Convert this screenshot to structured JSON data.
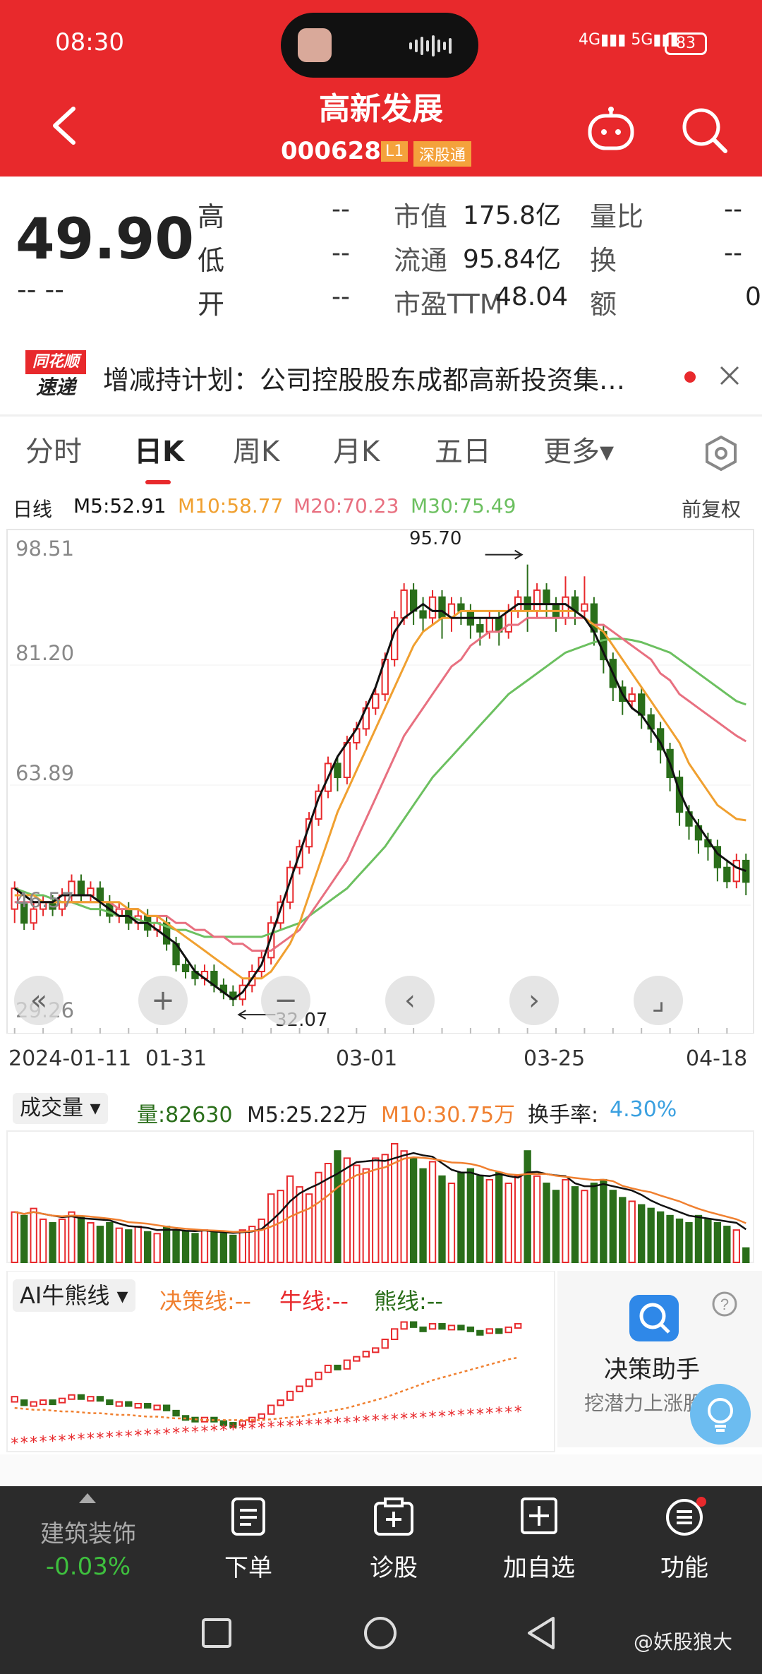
{
  "status_bar": {
    "time": "08:30",
    "network": "4G 5G",
    "battery": "83"
  },
  "header": {
    "title": "高新发展",
    "code": "000628",
    "level_badge": "L1",
    "market_badge": "深股通"
  },
  "quote": {
    "price": "49.90",
    "change": "-- --",
    "stats": [
      {
        "label": "高",
        "value": "--"
      },
      {
        "label": "低",
        "value": "--"
      },
      {
        "label": "开",
        "value": "--"
      },
      {
        "label": "市值",
        "value": "175.8亿"
      },
      {
        "label": "流通",
        "value": "95.84亿"
      },
      {
        "label": "市盈TTM",
        "value": "48.04"
      },
      {
        "label": "量比",
        "value": "--"
      },
      {
        "label": "换",
        "value": "--"
      },
      {
        "label": "额",
        "value": "0"
      }
    ]
  },
  "news": {
    "logo_top": "同花顺",
    "logo_bottom": "速递",
    "text": "增减持计划：公司控股股东成都高新投资集…"
  },
  "tabs": [
    "分时",
    "日K",
    "周K",
    "月K",
    "五日",
    "更多▾"
  ],
  "active_tab": "日K",
  "ma_line": {
    "label": "日线",
    "m5": "M5:52.91",
    "m10": "M10:58.77",
    "m20": "M20:70.23",
    "m30": "M30:75.49",
    "adjust": "前复权"
  },
  "colors": {
    "brand": "#e8292c",
    "up": "#e8292c",
    "down": "#2a6e1a",
    "m5": "#111111",
    "m10": "#f0a030",
    "m20": "#e87080",
    "m30": "#6cc060"
  },
  "price_axis": [
    "98.51",
    "81.20",
    "63.89",
    "46.57",
    "29.26"
  ],
  "annotations": {
    "high": "95.70",
    "low": "32.07"
  },
  "x_axis": [
    "2024-01-11",
    "01-31",
    "03-01",
    "03-25",
    "04-18"
  ],
  "chart_controls": [
    "«",
    "+",
    "−",
    "‹",
    "›",
    "⌟"
  ],
  "chart_data": {
    "type": "candlestick",
    "ylim": [
      29.26,
      98.51
    ],
    "y_ticks": [
      "98.51",
      "81.20",
      "63.89",
      "46.57",
      "29.26"
    ],
    "x_ticks": [
      "2024-01-11",
      "01-31",
      "03-01",
      "03-25",
      "04-18"
    ],
    "candles": [
      [
        46,
        49,
        44,
        50
      ],
      [
        47,
        44,
        43,
        48
      ],
      [
        44,
        46,
        43,
        47
      ],
      [
        46,
        47,
        45,
        48
      ],
      [
        47,
        46,
        45,
        48
      ],
      [
        46,
        48,
        45,
        49
      ],
      [
        48,
        50,
        47,
        51
      ],
      [
        50,
        48,
        47,
        51
      ],
      [
        48,
        49,
        47,
        50
      ],
      [
        49,
        47,
        45,
        50
      ],
      [
        47,
        45,
        44,
        48
      ],
      [
        45,
        46,
        44,
        47
      ],
      [
        46,
        44,
        43,
        47
      ],
      [
        44,
        45,
        43,
        46
      ],
      [
        45,
        43,
        42,
        46
      ],
      [
        43,
        44,
        42,
        45
      ],
      [
        44,
        41,
        40,
        45
      ],
      [
        41,
        38,
        37,
        42
      ],
      [
        38,
        37,
        36,
        39
      ],
      [
        37,
        36,
        35,
        38
      ],
      [
        36,
        37,
        35,
        38
      ],
      [
        37,
        35,
        34,
        38
      ],
      [
        35,
        34,
        33,
        36
      ],
      [
        34,
        33,
        32,
        35
      ],
      [
        33,
        35,
        32.07,
        36
      ],
      [
        35,
        37,
        34,
        38
      ],
      [
        37,
        39,
        36,
        40
      ],
      [
        39,
        44,
        38,
        45
      ],
      [
        44,
        47,
        43,
        48
      ],
      [
        47,
        52,
        46,
        53
      ],
      [
        52,
        55,
        51,
        56
      ],
      [
        55,
        59,
        54,
        60
      ],
      [
        59,
        63,
        58,
        64
      ],
      [
        63,
        67,
        62,
        68
      ],
      [
        67,
        65,
        63,
        68
      ],
      [
        65,
        70,
        64,
        71
      ],
      [
        70,
        72,
        69,
        73
      ],
      [
        72,
        75,
        71,
        76
      ],
      [
        75,
        77,
        74,
        78
      ],
      [
        77,
        82,
        76,
        83
      ],
      [
        82,
        88,
        81,
        89
      ],
      [
        88,
        92,
        87,
        93
      ],
      [
        92,
        89,
        87,
        93
      ],
      [
        89,
        88,
        86,
        91
      ],
      [
        88,
        91,
        87,
        92
      ],
      [
        91,
        88,
        85,
        92
      ],
      [
        88,
        90,
        86,
        91
      ],
      [
        90,
        89,
        87,
        91
      ],
      [
        89,
        87,
        85,
        90
      ],
      [
        87,
        86,
        84,
        88
      ],
      [
        86,
        88,
        85,
        89
      ],
      [
        88,
        86,
        84,
        89
      ],
      [
        86,
        89,
        85,
        90
      ],
      [
        89,
        91,
        88,
        92
      ],
      [
        91,
        89,
        86,
        95.7
      ],
      [
        89,
        92,
        88,
        93
      ],
      [
        92,
        90,
        88,
        93
      ],
      [
        90,
        88,
        86,
        91
      ],
      [
        88,
        91,
        87,
        94
      ],
      [
        91,
        89,
        87,
        92
      ],
      [
        89,
        90,
        88,
        94
      ],
      [
        90,
        86,
        84,
        91
      ],
      [
        86,
        82,
        80,
        87
      ],
      [
        82,
        78,
        76,
        83
      ],
      [
        78,
        76,
        74,
        79
      ],
      [
        76,
        77,
        75,
        78
      ],
      [
        77,
        74,
        72,
        78
      ],
      [
        74,
        72,
        70,
        75
      ],
      [
        72,
        69,
        67,
        73
      ],
      [
        69,
        65,
        63,
        70
      ],
      [
        65,
        60,
        58,
        66
      ],
      [
        60,
        58,
        56,
        61
      ],
      [
        58,
        56,
        54,
        59
      ],
      [
        56,
        55,
        53,
        57
      ],
      [
        55,
        52,
        50,
        56
      ],
      [
        52,
        50,
        49,
        53
      ],
      [
        50,
        53,
        49,
        54
      ],
      [
        53,
        49.9,
        48,
        54
      ]
    ],
    "ma5": [
      49,
      48,
      47,
      47,
      47,
      48,
      48,
      48,
      48,
      47,
      46,
      45,
      45,
      44,
      44,
      43,
      42,
      41,
      39,
      37,
      36,
      35,
      34,
      33,
      34,
      36,
      38,
      42,
      46,
      50,
      54,
      58,
      62,
      65,
      68,
      70,
      72,
      75,
      78,
      82,
      86,
      88,
      89,
      90,
      89,
      89,
      88,
      88,
      88,
      88,
      88,
      88,
      89,
      90,
      90,
      90,
      90,
      90,
      90,
      89,
      88,
      86,
      83,
      80,
      77,
      75,
      74,
      72,
      70,
      67,
      63,
      60,
      58,
      56,
      54,
      53,
      52,
      51.5
    ],
    "ma10": [
      48,
      48,
      48,
      47,
      47,
      47,
      47,
      47,
      47,
      47,
      47,
      47,
      46,
      46,
      45,
      45,
      44,
      43,
      42,
      41,
      40,
      39,
      38,
      37,
      36,
      36,
      36,
      37,
      39,
      41,
      44,
      48,
      52,
      56,
      60,
      63,
      66,
      69,
      72,
      75,
      78,
      81,
      84,
      86,
      87,
      88,
      88,
      89,
      89,
      89,
      89,
      89,
      89,
      89,
      89,
      89,
      89,
      89,
      89,
      89,
      88,
      87,
      86,
      84,
      82,
      80,
      78,
      76,
      74,
      72,
      70,
      67,
      65,
      63,
      61,
      60,
      59,
      58.8
    ],
    "ma20": [
      47,
      47,
      47,
      47,
      47,
      47,
      47,
      47,
      47,
      47,
      47,
      46,
      46,
      46,
      45,
      45,
      45,
      44,
      44,
      43,
      43,
      42,
      42,
      41,
      41,
      40,
      40,
      40,
      41,
      42,
      43,
      45,
      47,
      49,
      51,
      53,
      56,
      59,
      62,
      65,
      68,
      71,
      73,
      75,
      77,
      79,
      81,
      82,
      84,
      85,
      86,
      86,
      87,
      87,
      88,
      88,
      88,
      88,
      88,
      88,
      88,
      87,
      87,
      86,
      85,
      84,
      83,
      82,
      80,
      79,
      77,
      76,
      75,
      74,
      73,
      72,
      71,
      70.2
    ],
    "ma30": [
      49,
      48.5,
      48,
      48,
      47.5,
      47,
      47,
      46.5,
      46,
      46,
      45.5,
      45,
      45,
      44.5,
      44,
      44,
      43.5,
      43,
      43,
      42.5,
      42,
      42,
      42,
      42,
      42,
      42,
      42,
      42.5,
      43,
      43.5,
      44,
      45,
      46,
      47,
      48,
      49,
      50.5,
      52,
      53.5,
      55,
      57,
      59,
      61,
      63,
      65,
      66.5,
      68,
      69.5,
      71,
      72.5,
      74,
      75.5,
      77,
      78,
      79,
      80,
      81,
      82,
      83,
      83.5,
      84,
      84.5,
      84.8,
      85,
      85,
      84.8,
      84.5,
      84,
      83.5,
      83,
      82,
      81,
      80,
      79,
      78,
      77,
      76,
      75.5
    ]
  },
  "volume": {
    "selector": "成交量",
    "amount": "量:82630",
    "m5": "M5:25.22万",
    "m10": "M10:30.75万",
    "turnover_label": "换手率:",
    "turnover_value": "4.30%",
    "bars": [
      28,
      26,
      30,
      24,
      22,
      24,
      28,
      25,
      22,
      20,
      22,
      19,
      18,
      20,
      17,
      16,
      20,
      18,
      17,
      16,
      18,
      17,
      16,
      15,
      18,
      20,
      24,
      38,
      40,
      48,
      42,
      38,
      50,
      55,
      62,
      58,
      54,
      52,
      58,
      60,
      66,
      62,
      58,
      52,
      56,
      48,
      44,
      50,
      52,
      48,
      46,
      50,
      44,
      48,
      62,
      48,
      44,
      40,
      46,
      42,
      40,
      44,
      46,
      40,
      36,
      34,
      32,
      30,
      28,
      26,
      24,
      22,
      26,
      24,
      22,
      20,
      18,
      8
    ]
  },
  "ai": {
    "selector": "AI牛熊线",
    "decision_label": "决策线:--",
    "bull_label": "牛线:--",
    "bear_label": "熊线:--",
    "assistant_title": "决策助手",
    "assistant_sub": "挖潜力上涨股"
  },
  "bottom_nav": {
    "sector_name": "建筑装饰",
    "sector_change": "-0.03%",
    "items": [
      "下单",
      "诊股",
      "加自选",
      "功能"
    ]
  },
  "watermark": "@妖股狼大"
}
